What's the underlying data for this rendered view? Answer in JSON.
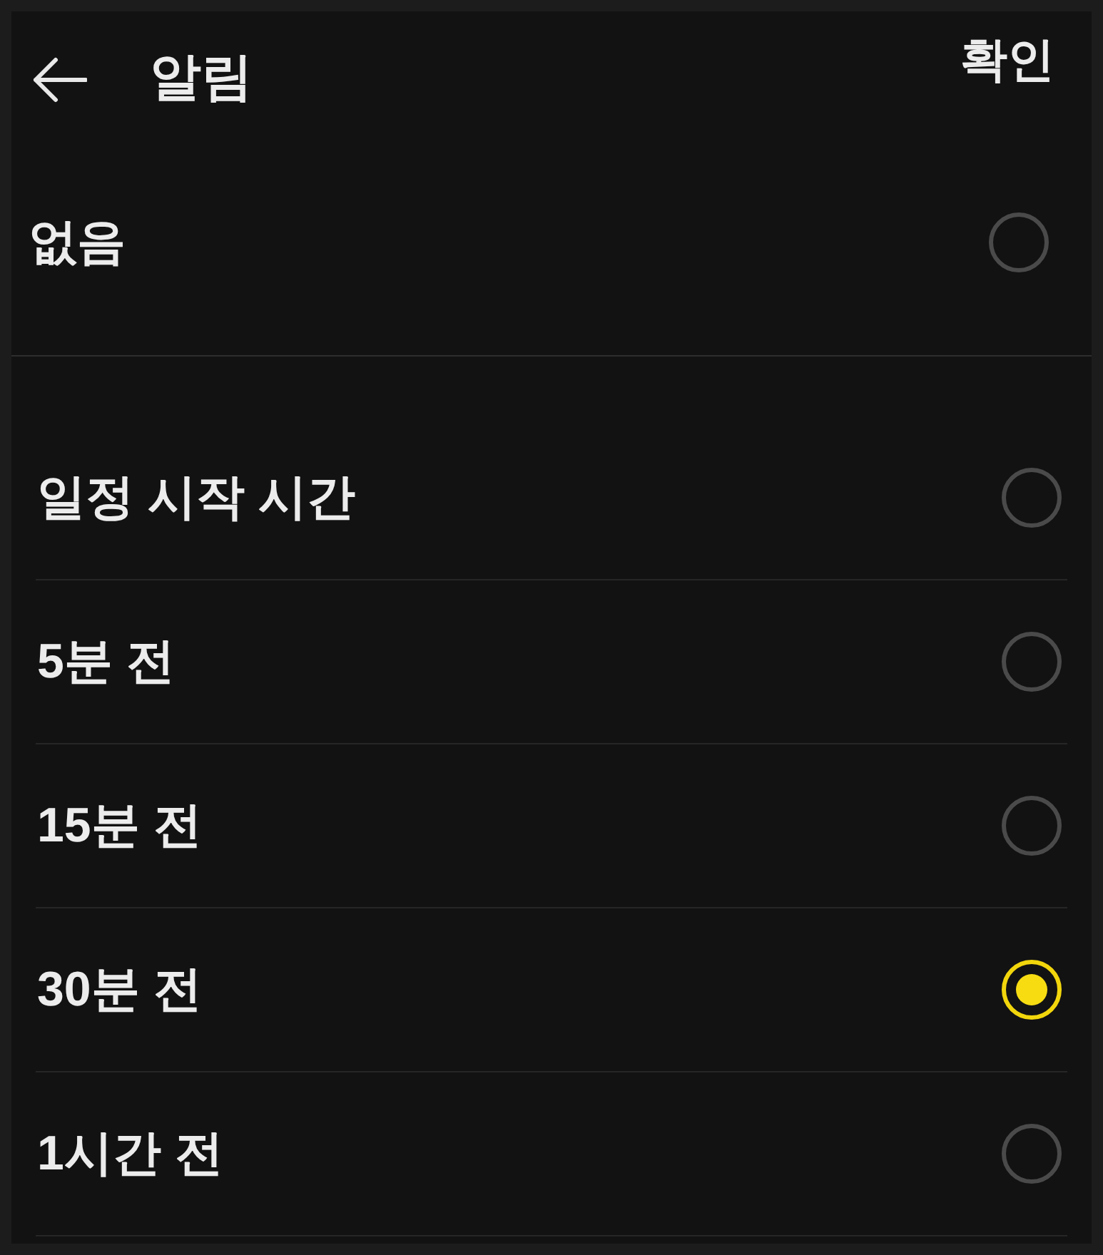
{
  "header": {
    "title": "알림",
    "confirm": "확인"
  },
  "sections": [
    {
      "options": [
        {
          "label": "없음",
          "selected": false
        }
      ]
    },
    {
      "options": [
        {
          "label": "일정 시작 시간",
          "selected": false
        },
        {
          "label": "5분 전",
          "selected": false
        },
        {
          "label": "15분 전",
          "selected": false
        },
        {
          "label": "30분 전",
          "selected": true
        },
        {
          "label": "1시간 전",
          "selected": false
        }
      ]
    }
  ]
}
